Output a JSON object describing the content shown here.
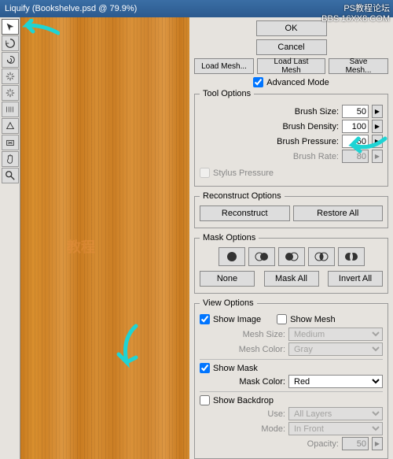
{
  "title": "Liquify (Bookshelve.psd @ 79.9%)",
  "buttons": {
    "ok": "OK",
    "cancel": "Cancel",
    "loadMesh": "Load Mesh...",
    "loadLastMesh": "Load Last Mesh",
    "saveMesh": "Save Mesh..."
  },
  "advancedMode": "Advanced Mode",
  "toolOptions": {
    "legend": "Tool Options",
    "brushSize": {
      "label": "Brush Size:",
      "value": "50"
    },
    "brushDensity": {
      "label": "Brush Density:",
      "value": "100"
    },
    "brushPressure": {
      "label": "Brush Pressure:",
      "value": "60"
    },
    "brushRate": {
      "label": "Brush Rate:",
      "value": "80"
    },
    "stylusPressure": "Stylus Pressure"
  },
  "reconstruct": {
    "legend": "Reconstruct Options",
    "reconstruct": "Reconstruct",
    "restoreAll": "Restore All"
  },
  "maskOptions": {
    "legend": "Mask Options",
    "none": "None",
    "maskAll": "Mask All",
    "invertAll": "Invert All"
  },
  "viewOptions": {
    "legend": "View Options",
    "showImage": "Show Image",
    "showMesh": "Show Mesh",
    "meshSize": {
      "label": "Mesh Size:",
      "value": "Medium"
    },
    "meshColor": {
      "label": "Mesh Color:",
      "value": "Gray"
    },
    "showMask": "Show Mask",
    "maskColor": {
      "label": "Mask Color:",
      "value": "Red"
    },
    "showBackdrop": "Show Backdrop",
    "use": {
      "label": "Use:",
      "value": "All Layers"
    },
    "mode": {
      "label": "Mode:",
      "value": "In Front"
    },
    "opacity": {
      "label": "Opacity:",
      "value": "50"
    }
  },
  "watermark": {
    "line1": "PS教程论坛",
    "line2": "BBS.16XX8.COM",
    "center": "教程"
  }
}
